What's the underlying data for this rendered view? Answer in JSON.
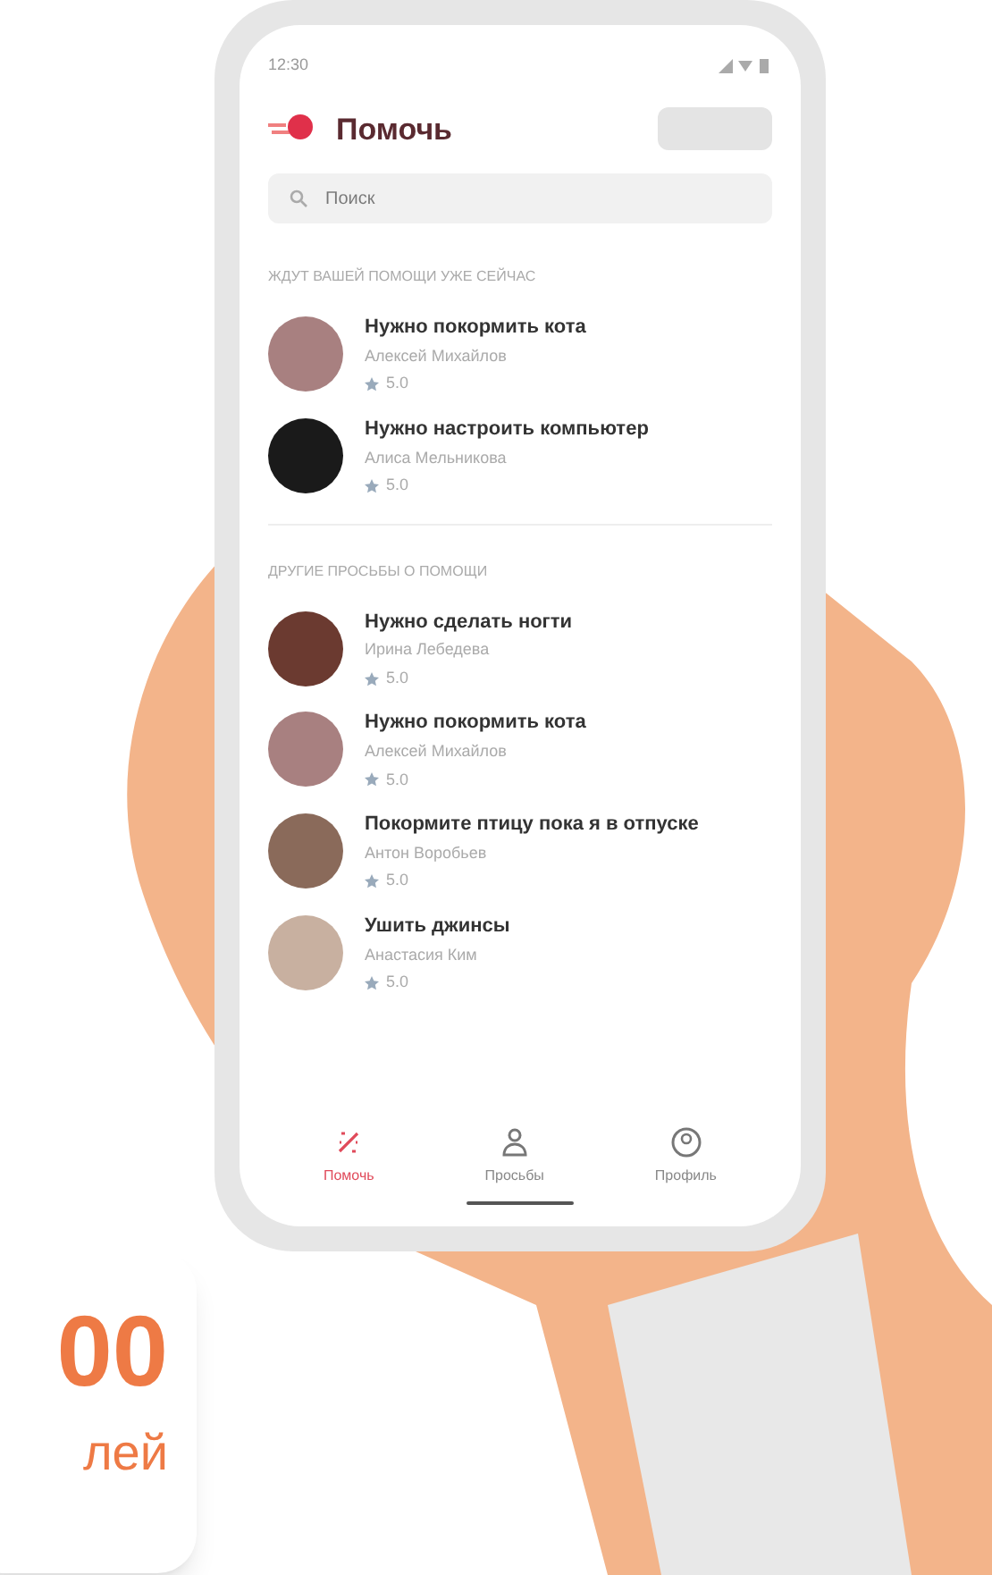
{
  "status_bar": {
    "time": "12:30"
  },
  "header": {
    "title": "Помочь"
  },
  "search": {
    "placeholder": "Поиск"
  },
  "sections": [
    {
      "title": "ЖДУТ ВАШЕЙ ПОМОЩИ УЖЕ СЕЙЧАС",
      "requests": [
        {
          "title": "Нужно покормить кота",
          "author": "Алексей Михайлов",
          "rating": "5.0",
          "color": "#a88080"
        },
        {
          "title": "Нужно настроить компьютер",
          "author": "Алиса Мельникова",
          "rating": "5.0",
          "color": "#1a1a1a"
        }
      ]
    },
    {
      "title": "ДРУГИЕ ПРОСЬБЫ О ПОМОЩИ",
      "requests": [
        {
          "title": "Нужно сделать ногти",
          "author": "Ирина Лебедева",
          "rating": "5.0",
          "color": "#6b3a30"
        },
        {
          "title": "Нужно покормить кота",
          "author": "Алексей Михайлов",
          "rating": "5.0",
          "color": "#a88080"
        },
        {
          "title": "Покормите птицу пока я в отпуске",
          "author": "Антон Воробьев",
          "rating": "5.0",
          "color": "#8a6a5a"
        },
        {
          "title": "Ушить джинсы",
          "author": "Анастасия Ким",
          "rating": "5.0",
          "color": "#c8b0a0"
        }
      ]
    }
  ],
  "tabs": [
    {
      "label": "Помочь",
      "selected": true,
      "kind": "help"
    },
    {
      "label": "Просьбы",
      "selected": false,
      "kind": "requests"
    },
    {
      "label": "Профиль",
      "selected": false,
      "kind": "profile"
    }
  ],
  "promo_card": {
    "number": "00",
    "caption": "лей"
  }
}
